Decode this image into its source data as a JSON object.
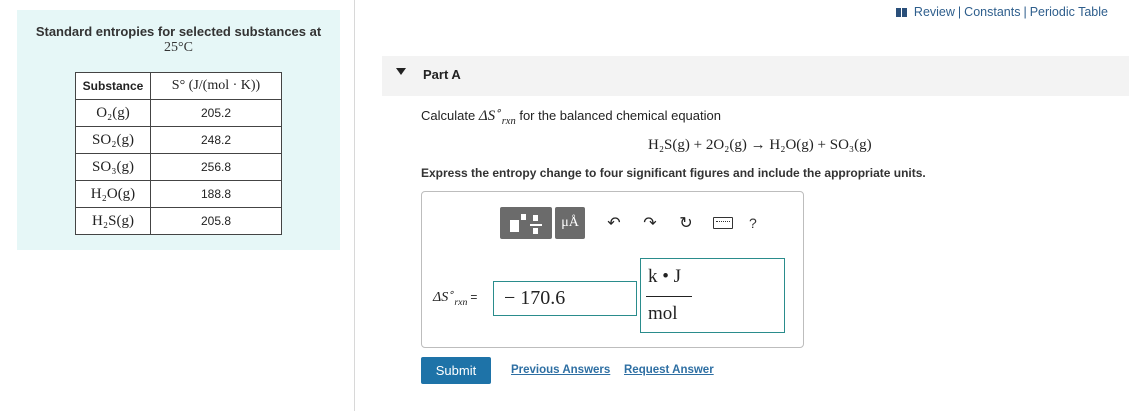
{
  "table": {
    "title_line1": "Standard entropies for selected substances at",
    "title_line2": "25°C",
    "header_substance": "Substance",
    "header_entropy": "S° (J/(mol · K))",
    "rows": [
      {
        "substance": "O₂(g)",
        "value": "205.2"
      },
      {
        "substance": "SO₂(g)",
        "value": "248.2"
      },
      {
        "substance": "SO₃(g)",
        "value": "256.8"
      },
      {
        "substance": "H₂O(g)",
        "value": "188.8"
      },
      {
        "substance": "H₂S(g)",
        "value": "205.8"
      }
    ]
  },
  "top_links": {
    "review": "Review",
    "sep": "|",
    "constants": "Constants",
    "periodic": "Periodic Table"
  },
  "part": {
    "title": "Part A"
  },
  "question": {
    "prompt_pre": "Calculate",
    "delta_s": "ΔS",
    "sup": "∘",
    "sub": "rxn",
    "prompt_post": "for the balanced chemical equation",
    "equation": "H₂S(g) + 2O₂(g) → H₂O(g) + SO₃(g)",
    "instruction": "Express the entropy change to four significant figures and include the appropriate units."
  },
  "toolbar": {
    "units_label": "μÅ",
    "undo": "↶",
    "redo": "↷",
    "reset": "↻",
    "help": "?"
  },
  "answer": {
    "label": "ΔS",
    "label_sup": "∘",
    "label_sub": "rxn",
    "equals": "=",
    "value": "− 170.6",
    "units_num": "k • J",
    "units_den": "mol"
  },
  "actions": {
    "submit": "Submit",
    "previous": "Previous Answers",
    "request": "Request Answer"
  }
}
